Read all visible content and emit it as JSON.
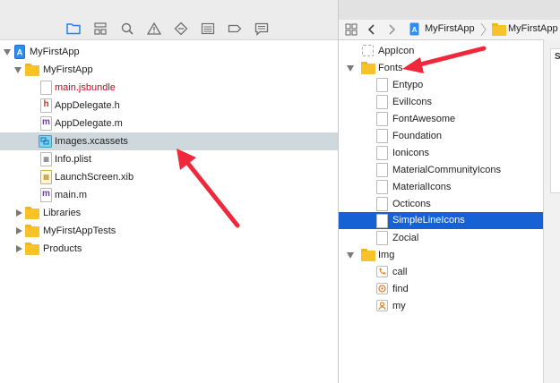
{
  "navigator": {
    "toolbar_icons": [
      "folder-icon",
      "hierarchy-icon",
      "search-icon",
      "warning-icon",
      "diamond-icon",
      "list-icon",
      "tag-icon",
      "comment-icon"
    ],
    "items": [
      {
        "name": "project-root",
        "label": "MyFirstApp",
        "kind": "project",
        "expanded": true
      },
      {
        "name": "group-myfirstapp",
        "label": "MyFirstApp",
        "kind": "folder",
        "expanded": true
      },
      {
        "name": "file-main-jsbundle",
        "label": "main.jsbundle",
        "kind": "file",
        "missing": true
      },
      {
        "name": "file-appdelegate-h",
        "label": "AppDelegate.h",
        "kind": "file-h"
      },
      {
        "name": "file-appdelegate-m",
        "label": "AppDelegate.m",
        "kind": "file-m"
      },
      {
        "name": "file-images-xcassets",
        "label": "Images.xcassets",
        "kind": "assets",
        "selected": true
      },
      {
        "name": "file-info-plist",
        "label": "Info.plist",
        "kind": "file"
      },
      {
        "name": "file-launchscreen-xib",
        "label": "LaunchScreen.xib",
        "kind": "xib"
      },
      {
        "name": "file-main-m",
        "label": "main.m",
        "kind": "file-m"
      },
      {
        "name": "group-libraries",
        "label": "Libraries",
        "kind": "folder",
        "expanded": false
      },
      {
        "name": "group-myfirstapptests",
        "label": "MyFirstAppTests",
        "kind": "folder",
        "expanded": false
      },
      {
        "name": "group-products",
        "label": "Products",
        "kind": "folder",
        "expanded": false
      }
    ]
  },
  "jumpbar": {
    "crumb1": "MyFirstApp",
    "crumb2": "MyFirstApp"
  },
  "assets": {
    "items": [
      {
        "name": "asset-appicon",
        "label": "AppIcon",
        "kind": "appicon"
      },
      {
        "name": "asset-fonts",
        "label": "Fonts",
        "kind": "folder",
        "expanded": true
      },
      {
        "name": "asset-entypo",
        "label": "Entypo",
        "kind": "file"
      },
      {
        "name": "asset-evilicons",
        "label": "EvilIcons",
        "kind": "file"
      },
      {
        "name": "asset-fontawesome",
        "label": "FontAwesome",
        "kind": "file"
      },
      {
        "name": "asset-foundation",
        "label": "Foundation",
        "kind": "file"
      },
      {
        "name": "asset-ionicons",
        "label": "Ionicons",
        "kind": "file"
      },
      {
        "name": "asset-materialcommunityicons",
        "label": "MaterialCommunityIcons",
        "kind": "file"
      },
      {
        "name": "asset-materialicons",
        "label": "MaterialIcons",
        "kind": "file"
      },
      {
        "name": "asset-octicons",
        "label": "Octicons",
        "kind": "file"
      },
      {
        "name": "asset-simplelineicons",
        "label": "SimpleLineIcons",
        "kind": "file",
        "selected": true
      },
      {
        "name": "asset-zocial",
        "label": "Zocial",
        "kind": "file"
      },
      {
        "name": "asset-img",
        "label": "Img",
        "kind": "folder",
        "expanded": true
      },
      {
        "name": "asset-call",
        "label": "call",
        "kind": "image"
      },
      {
        "name": "asset-find",
        "label": "find",
        "kind": "image"
      },
      {
        "name": "asset-my",
        "label": "my",
        "kind": "image"
      }
    ]
  },
  "inspector": {
    "label": "S"
  },
  "colors": {
    "selection_blue": "#1662d4",
    "missing_red": "#d0021b",
    "toolbar_active": "#2a7ff0",
    "annotation_red": "#f0283c"
  }
}
